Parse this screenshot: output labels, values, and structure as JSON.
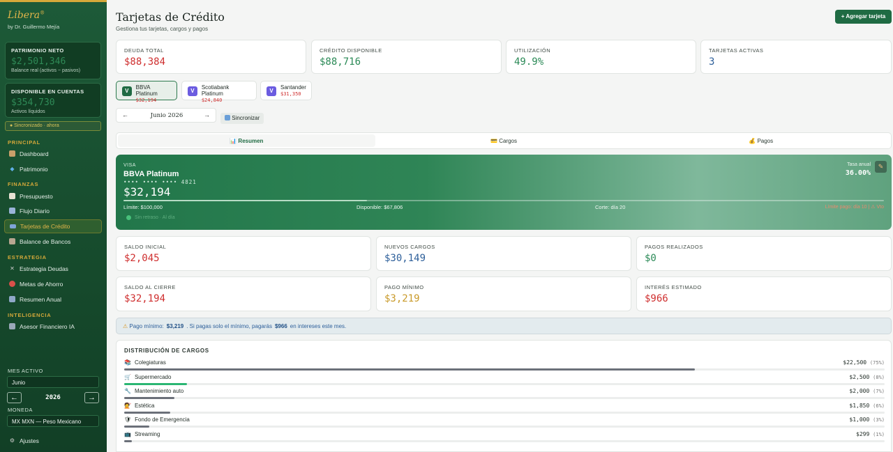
{
  "brand": {
    "name": "Libera",
    "mark": "®",
    "author": "by Dr. Guillermo Mejía"
  },
  "sidebar": {
    "patrimonio": {
      "label": "PATRIMONIO NETO",
      "value": "$2,501,346",
      "sub": "Balance real (activos − pasivos)"
    },
    "disponible": {
      "label": "DISPONIBLE EN CUENTAS",
      "value": "$354,730",
      "sub": "Activos líquidos"
    },
    "sync": "● Sincronizado · ahora",
    "sections": {
      "principal": "PRINCIPAL",
      "finanzas": "FINANZAS",
      "estrategia": "ESTRATEGIA",
      "inteligencia": "INTELIGENCIA"
    },
    "items": {
      "dashboard": "Dashboard",
      "patrimonio": "Patrimonio",
      "presupuesto": "Presupuesto",
      "flujo": "Flujo Diario",
      "tarjetas": "Tarjetas de Crédito",
      "bancos": "Balance de Bancos",
      "deudas": "Estrategia Deudas",
      "ahorro": "Metas de Ahorro",
      "anual": "Resumen Anual",
      "asesor": "Asesor Financiero IA",
      "ajustes": "Ajustes"
    },
    "mes_label": "MES ACTIVO",
    "mes_value": "Junio",
    "year": "2026",
    "prev": "←",
    "next": "→",
    "moneda_label": "MONEDA",
    "moneda_value": "MX MXN — Peso Mexicano"
  },
  "header": {
    "title": "Tarjetas de Crédito",
    "subtitle": "Gestiona tus tarjetas, cargos y pagos",
    "add_button": "+ Agregar tarjeta"
  },
  "stats": [
    {
      "label": "DEUDA TOTAL",
      "value": "$88,384"
    },
    {
      "label": "CRÉDITO DISPONIBLE",
      "value": "$88,716"
    },
    {
      "label": "UTILIZACIÓN",
      "value": "49.9%"
    },
    {
      "label": "TARJETAS ACTIVAS",
      "value": "3"
    }
  ],
  "cards": [
    {
      "badge": "V",
      "name": "BBVA Platinum",
      "amount": "$32,194",
      "color": "#1f6b43"
    },
    {
      "badge": "V",
      "name": "Scotiabank Platinum",
      "amount": "$24,840",
      "color": "#6b5ce0"
    },
    {
      "badge": "V",
      "name": "Santander",
      "amount": "$31,350",
      "color": "#6b5ce0"
    }
  ],
  "month_nav": {
    "prev": "←",
    "month": "Junio 2026",
    "next": "→"
  },
  "sync_button": "Sincronizar",
  "tabs": [
    {
      "icon": "📊",
      "label": "Resumen"
    },
    {
      "icon": "💳",
      "label": "Cargos"
    },
    {
      "icon": "💰",
      "label": "Pagos"
    }
  ],
  "card_detail": {
    "network": "VISA",
    "name": "BBVA Platinum",
    "number": "•••• •••• •••• 4821",
    "balance": "$32,194",
    "limit": "Límite: $100,000",
    "available": "Disponible: $67,806",
    "cut": "Corte: día 20",
    "due": "Límite pago: día 10 | ⚠ Vto",
    "utilization": 0.32,
    "rate_label": "Tasa anual",
    "rate": "36.00%",
    "status": "Sin retraso · Al día"
  },
  "metrics": [
    {
      "label": "SALDO INICIAL",
      "value": "$2,045"
    },
    {
      "label": "NUEVOS CARGOS",
      "value": "$30,149"
    },
    {
      "label": "PAGOS REALIZADOS",
      "value": "$0"
    },
    {
      "label": "SALDO AL CIERRE",
      "value": "$32,194"
    },
    {
      "label": "PAGO MÍNIMO",
      "value": "$3,219"
    },
    {
      "label": "INTERÉS ESTIMADO",
      "value": "$966"
    }
  ],
  "alert": {
    "prefix": "Pago mínimo:",
    "amount": "$3,219",
    "mid": ". Si pagas solo el mínimo, pagarás",
    "interest": "$966",
    "suffix": "en intereses este mes."
  },
  "distribution": {
    "title": "DISTRIBUCIÓN DE CARGOS",
    "items": [
      {
        "icon": "📚",
        "label": "Colegiaturas",
        "amount": "$22,500",
        "pct": "(75%)",
        "share": 0.75,
        "color": "#6b7079"
      },
      {
        "icon": "🛒",
        "label": "Supermercado",
        "amount": "$2,500",
        "pct": "(8%)",
        "share": 0.083,
        "color": "#2bb673"
      },
      {
        "icon": "🔧",
        "label": "Mantenimiento auto",
        "amount": "$2,000",
        "pct": "(7%)",
        "share": 0.066,
        "color": "#6b7079"
      },
      {
        "icon": "💇",
        "label": "Estética",
        "amount": "$1,850",
        "pct": "(6%)",
        "share": 0.061,
        "color": "#6b7079"
      },
      {
        "icon": "🛡",
        "label": "Fondo de Emergencia",
        "amount": "$1,000",
        "pct": "(3%)",
        "share": 0.033,
        "color": "#6b7079"
      },
      {
        "icon": "📺",
        "label": "Streaming",
        "amount": "$299",
        "pct": "(1%)",
        "share": 0.01,
        "color": "#6b7079"
      }
    ]
  }
}
